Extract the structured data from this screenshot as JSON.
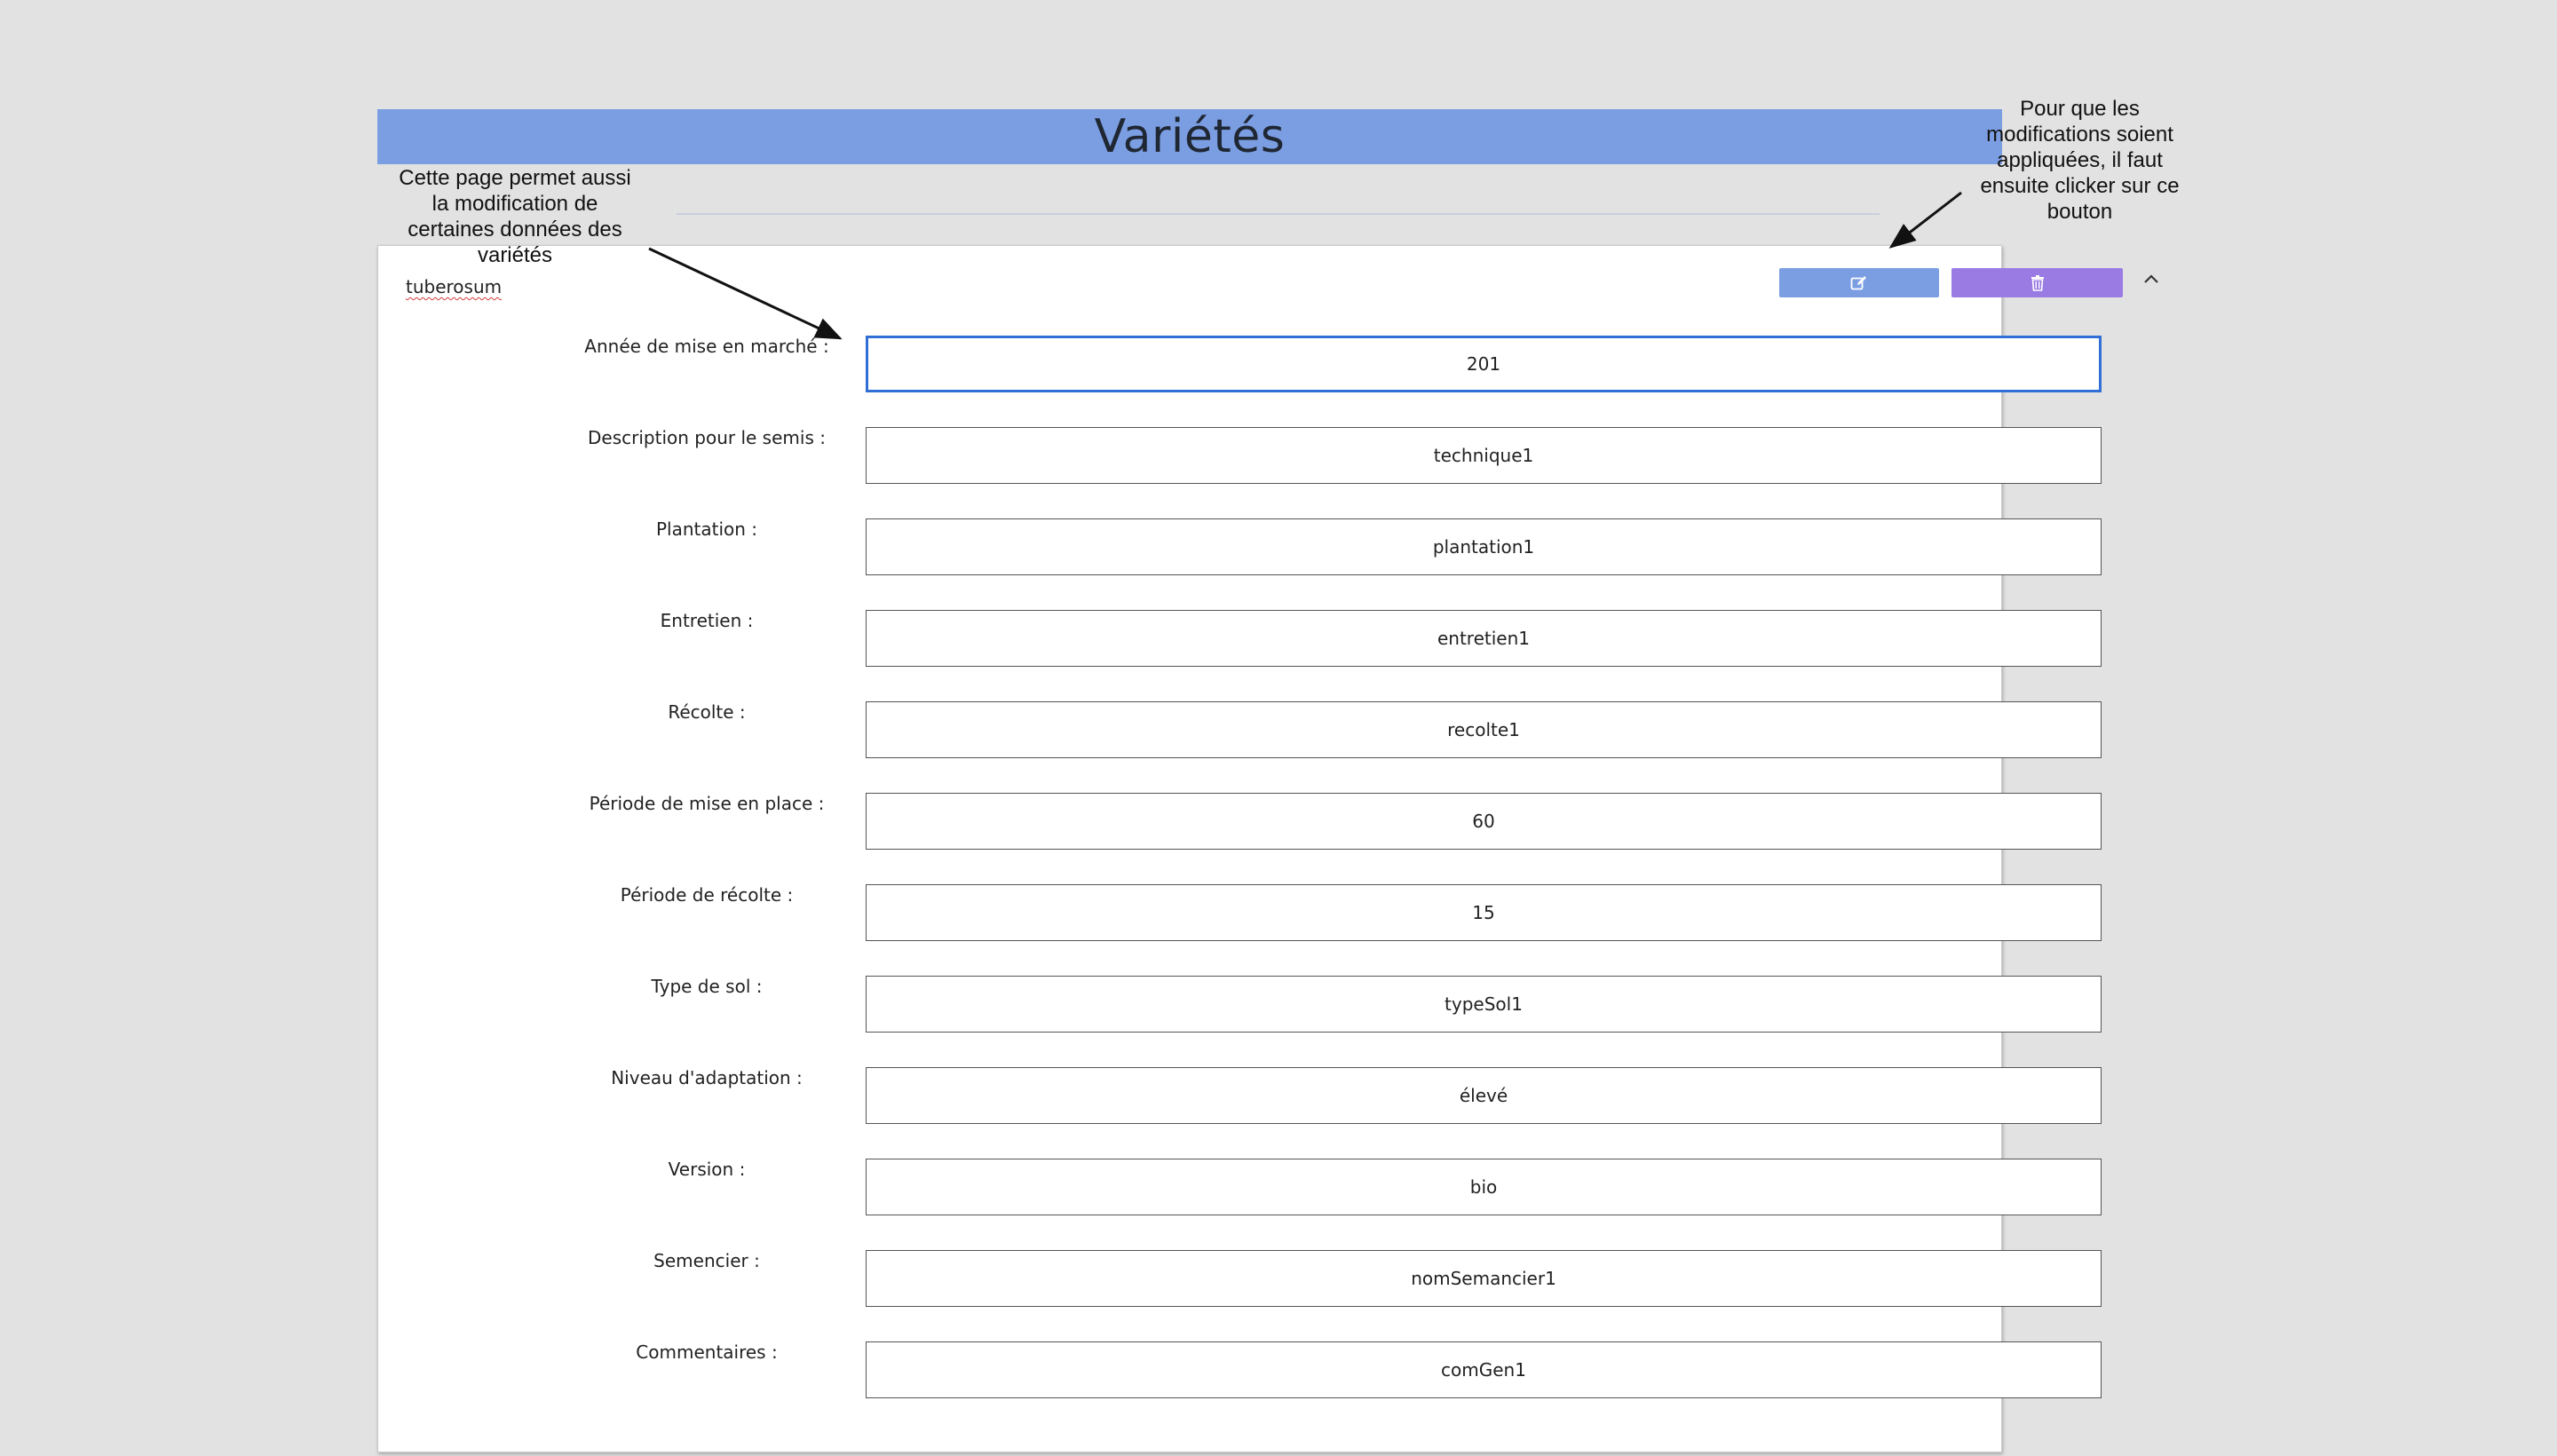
{
  "header": {
    "title": "Variétés"
  },
  "card": {
    "title": "tuberosum",
    "actions": {
      "edit_icon": "edit-icon",
      "delete_icon": "trash-icon",
      "collapse_icon": "chevron-up-icon"
    },
    "fields": [
      {
        "label": "Année de mise en marché :",
        "value": "201"
      },
      {
        "label": "Description pour le semis :",
        "value": "technique1"
      },
      {
        "label": "Plantation :",
        "value": "plantation1"
      },
      {
        "label": "Entretien :",
        "value": "entretien1"
      },
      {
        "label": "Récolte :",
        "value": "recolte1"
      },
      {
        "label": "Période de mise en place :",
        "value": "60"
      },
      {
        "label": "Période de récolte :",
        "value": "15"
      },
      {
        "label": "Type de sol :",
        "value": "typeSol1"
      },
      {
        "label": "Niveau d'adaptation :",
        "value": "élevé"
      },
      {
        "label": "Version :",
        "value": "bio"
      },
      {
        "label": "Semencier :",
        "value": "nomSemancier1"
      },
      {
        "label": "Commentaires :",
        "value": "comGen1"
      }
    ]
  },
  "annotations": {
    "left": "Cette page permet aussi la modification de certaines données des variétés",
    "right": "Pour que les modifications soient appliquées, il faut ensuite clicker sur ce bouton"
  },
  "colors": {
    "header": "#7b9ee3",
    "edit_button": "#7b9ee3",
    "delete_button": "#9a7be3",
    "focus_border": "#2f6fd6",
    "background": "#e2e2e2"
  }
}
